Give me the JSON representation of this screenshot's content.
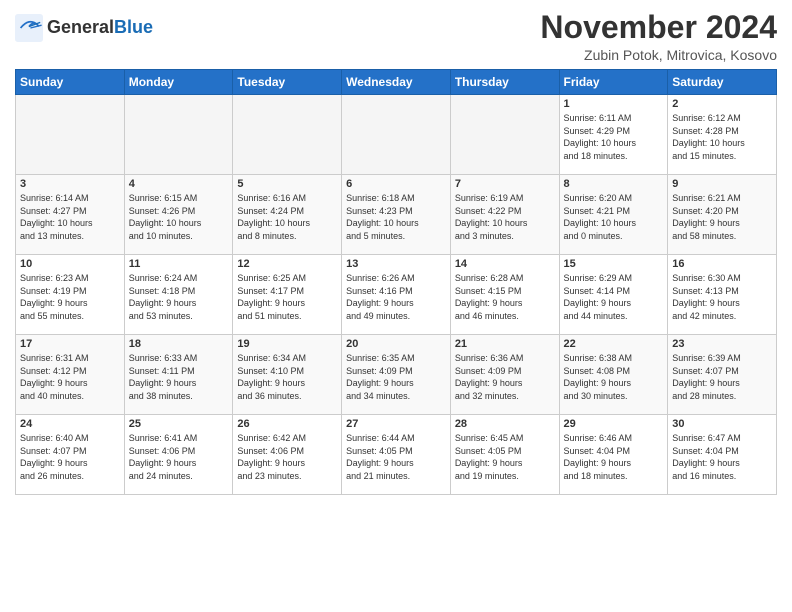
{
  "header": {
    "logo_general": "General",
    "logo_blue": "Blue",
    "title": "November 2024",
    "location": "Zubin Potok, Mitrovica, Kosovo"
  },
  "weekdays": [
    "Sunday",
    "Monday",
    "Tuesday",
    "Wednesday",
    "Thursday",
    "Friday",
    "Saturday"
  ],
  "weeks": [
    [
      {
        "day": "",
        "info": ""
      },
      {
        "day": "",
        "info": ""
      },
      {
        "day": "",
        "info": ""
      },
      {
        "day": "",
        "info": ""
      },
      {
        "day": "",
        "info": ""
      },
      {
        "day": "1",
        "info": "Sunrise: 6:11 AM\nSunset: 4:29 PM\nDaylight: 10 hours\nand 18 minutes."
      },
      {
        "day": "2",
        "info": "Sunrise: 6:12 AM\nSunset: 4:28 PM\nDaylight: 10 hours\nand 15 minutes."
      }
    ],
    [
      {
        "day": "3",
        "info": "Sunrise: 6:14 AM\nSunset: 4:27 PM\nDaylight: 10 hours\nand 13 minutes."
      },
      {
        "day": "4",
        "info": "Sunrise: 6:15 AM\nSunset: 4:26 PM\nDaylight: 10 hours\nand 10 minutes."
      },
      {
        "day": "5",
        "info": "Sunrise: 6:16 AM\nSunset: 4:24 PM\nDaylight: 10 hours\nand 8 minutes."
      },
      {
        "day": "6",
        "info": "Sunrise: 6:18 AM\nSunset: 4:23 PM\nDaylight: 10 hours\nand 5 minutes."
      },
      {
        "day": "7",
        "info": "Sunrise: 6:19 AM\nSunset: 4:22 PM\nDaylight: 10 hours\nand 3 minutes."
      },
      {
        "day": "8",
        "info": "Sunrise: 6:20 AM\nSunset: 4:21 PM\nDaylight: 10 hours\nand 0 minutes."
      },
      {
        "day": "9",
        "info": "Sunrise: 6:21 AM\nSunset: 4:20 PM\nDaylight: 9 hours\nand 58 minutes."
      }
    ],
    [
      {
        "day": "10",
        "info": "Sunrise: 6:23 AM\nSunset: 4:19 PM\nDaylight: 9 hours\nand 55 minutes."
      },
      {
        "day": "11",
        "info": "Sunrise: 6:24 AM\nSunset: 4:18 PM\nDaylight: 9 hours\nand 53 minutes."
      },
      {
        "day": "12",
        "info": "Sunrise: 6:25 AM\nSunset: 4:17 PM\nDaylight: 9 hours\nand 51 minutes."
      },
      {
        "day": "13",
        "info": "Sunrise: 6:26 AM\nSunset: 4:16 PM\nDaylight: 9 hours\nand 49 minutes."
      },
      {
        "day": "14",
        "info": "Sunrise: 6:28 AM\nSunset: 4:15 PM\nDaylight: 9 hours\nand 46 minutes."
      },
      {
        "day": "15",
        "info": "Sunrise: 6:29 AM\nSunset: 4:14 PM\nDaylight: 9 hours\nand 44 minutes."
      },
      {
        "day": "16",
        "info": "Sunrise: 6:30 AM\nSunset: 4:13 PM\nDaylight: 9 hours\nand 42 minutes."
      }
    ],
    [
      {
        "day": "17",
        "info": "Sunrise: 6:31 AM\nSunset: 4:12 PM\nDaylight: 9 hours\nand 40 minutes."
      },
      {
        "day": "18",
        "info": "Sunrise: 6:33 AM\nSunset: 4:11 PM\nDaylight: 9 hours\nand 38 minutes."
      },
      {
        "day": "19",
        "info": "Sunrise: 6:34 AM\nSunset: 4:10 PM\nDaylight: 9 hours\nand 36 minutes."
      },
      {
        "day": "20",
        "info": "Sunrise: 6:35 AM\nSunset: 4:09 PM\nDaylight: 9 hours\nand 34 minutes."
      },
      {
        "day": "21",
        "info": "Sunrise: 6:36 AM\nSunset: 4:09 PM\nDaylight: 9 hours\nand 32 minutes."
      },
      {
        "day": "22",
        "info": "Sunrise: 6:38 AM\nSunset: 4:08 PM\nDaylight: 9 hours\nand 30 minutes."
      },
      {
        "day": "23",
        "info": "Sunrise: 6:39 AM\nSunset: 4:07 PM\nDaylight: 9 hours\nand 28 minutes."
      }
    ],
    [
      {
        "day": "24",
        "info": "Sunrise: 6:40 AM\nSunset: 4:07 PM\nDaylight: 9 hours\nand 26 minutes."
      },
      {
        "day": "25",
        "info": "Sunrise: 6:41 AM\nSunset: 4:06 PM\nDaylight: 9 hours\nand 24 minutes."
      },
      {
        "day": "26",
        "info": "Sunrise: 6:42 AM\nSunset: 4:06 PM\nDaylight: 9 hours\nand 23 minutes."
      },
      {
        "day": "27",
        "info": "Sunrise: 6:44 AM\nSunset: 4:05 PM\nDaylight: 9 hours\nand 21 minutes."
      },
      {
        "day": "28",
        "info": "Sunrise: 6:45 AM\nSunset: 4:05 PM\nDaylight: 9 hours\nand 19 minutes."
      },
      {
        "day": "29",
        "info": "Sunrise: 6:46 AM\nSunset: 4:04 PM\nDaylight: 9 hours\nand 18 minutes."
      },
      {
        "day": "30",
        "info": "Sunrise: 6:47 AM\nSunset: 4:04 PM\nDaylight: 9 hours\nand 16 minutes."
      }
    ]
  ]
}
